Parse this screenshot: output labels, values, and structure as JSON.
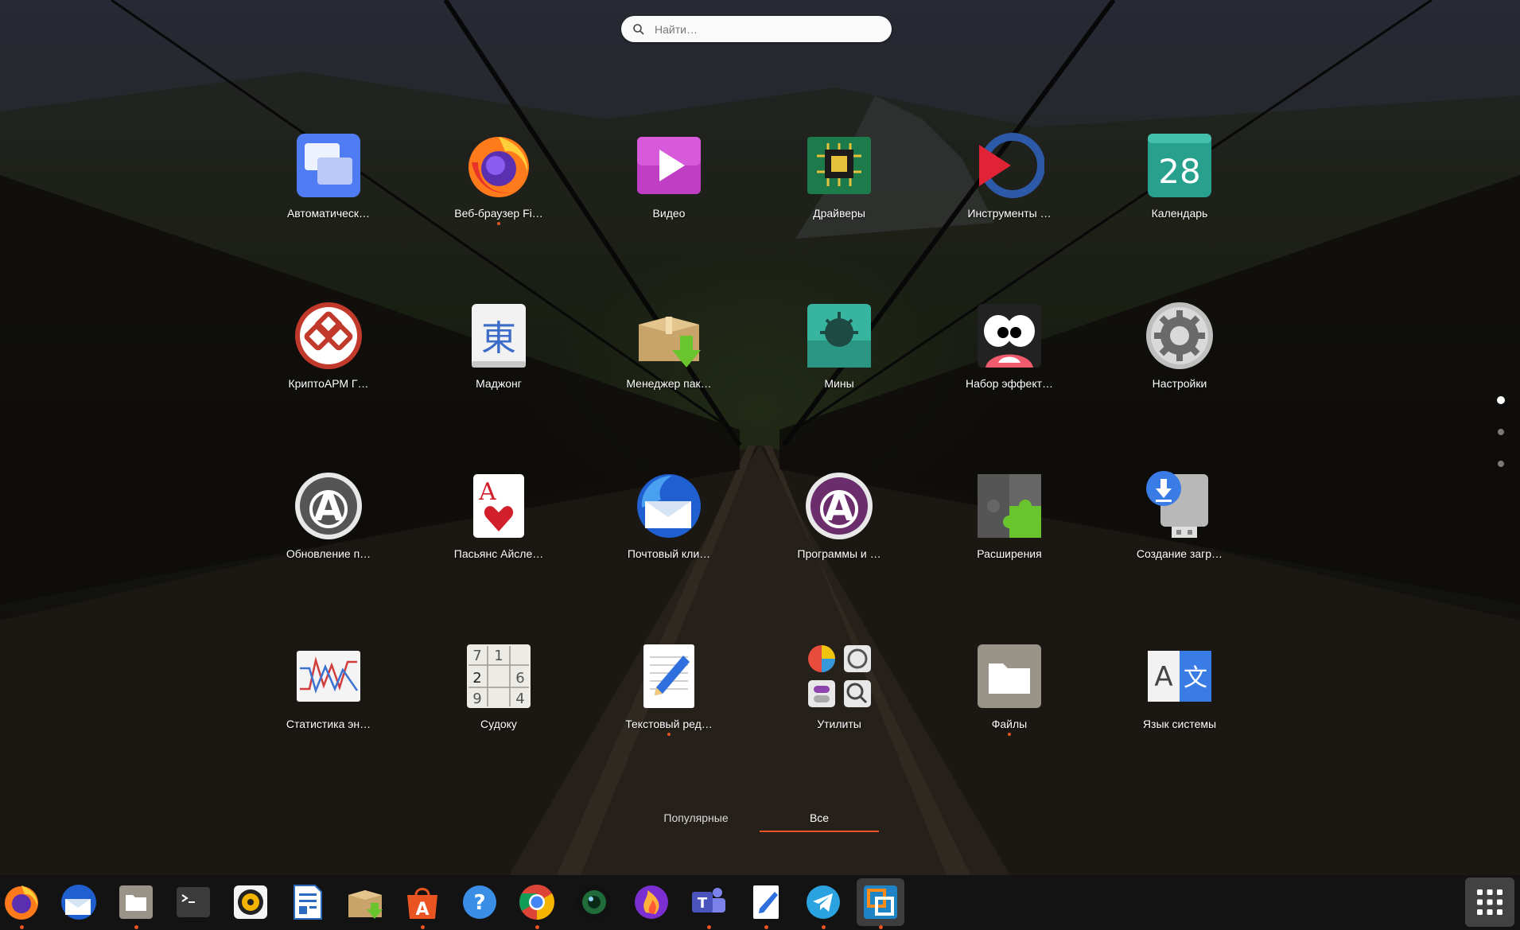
{
  "search": {
    "placeholder": "Найти…",
    "value": ""
  },
  "apps": [
    {
      "label": "Автоматическ…",
      "icon": "desktop-icon",
      "running": false
    },
    {
      "label": "Веб-браузер Fi…",
      "icon": "firefox-icon",
      "running": true
    },
    {
      "label": "Видео",
      "icon": "video-player-icon",
      "running": false
    },
    {
      "label": "Драйверы",
      "icon": "chip-icon",
      "running": false
    },
    {
      "label": "Инструменты …",
      "icon": "remote-desktop-icon",
      "running": false
    },
    {
      "label": "Календарь",
      "icon": "calendar-icon",
      "running": false,
      "calendar_day": "28"
    },
    {
      "label": "КриптоАРМ Г…",
      "icon": "crypto-chain-icon",
      "running": false
    },
    {
      "label": "Маджонг",
      "icon": "mahjong-tile-icon",
      "running": false,
      "glyph": "東"
    },
    {
      "label": "Менеджер пак…",
      "icon": "package-box-icon",
      "running": false
    },
    {
      "label": "Мины",
      "icon": "mine-icon",
      "running": false
    },
    {
      "label": "Набор эффект…",
      "icon": "cheese-face-icon",
      "running": false
    },
    {
      "label": "Настройки",
      "icon": "gear-icon",
      "running": false
    },
    {
      "label": "Обновление п…",
      "icon": "software-update-icon",
      "running": false
    },
    {
      "label": "Пасьянс Айсле…",
      "icon": "playing-card-icon",
      "running": false,
      "glyph": "A"
    },
    {
      "label": "Почтовый кли…",
      "icon": "thunderbird-icon",
      "running": false
    },
    {
      "label": "Программы и …",
      "icon": "software-center-icon",
      "running": false
    },
    {
      "label": "Расширения",
      "icon": "puzzle-icon",
      "running": false
    },
    {
      "label": "Создание загр…",
      "icon": "usb-download-icon",
      "running": false
    },
    {
      "label": "Статистика эн…",
      "icon": "power-graph-icon",
      "running": false
    },
    {
      "label": "Судоку",
      "icon": "sudoku-grid-icon",
      "running": false,
      "digits": [
        "7",
        "1",
        "2",
        "6",
        "9",
        "4"
      ]
    },
    {
      "label": "Текстовый ред…",
      "icon": "text-editor-icon",
      "running": true
    },
    {
      "label": "Утилиты",
      "icon": "utilities-folder-icon",
      "running": false
    },
    {
      "label": "Файлы",
      "icon": "files-folder-icon",
      "running": true
    },
    {
      "label": "Язык системы",
      "icon": "language-icon",
      "running": false,
      "glyph_a": "A",
      "glyph_b": "文"
    }
  ],
  "view_switcher": {
    "popular": "Популярные",
    "all": "Все",
    "active": "all"
  },
  "pages": {
    "count": 3,
    "current": 1
  },
  "dock": [
    {
      "name": "firefox-icon",
      "running": true
    },
    {
      "name": "thunderbird-icon",
      "running": false
    },
    {
      "name": "files-icon",
      "running": true
    },
    {
      "name": "terminal-icon",
      "running": false
    },
    {
      "name": "rhythmbox-icon",
      "running": false
    },
    {
      "name": "libreoffice-writer-icon",
      "running": false
    },
    {
      "name": "package-manager-icon",
      "running": false
    },
    {
      "name": "software-center-icon",
      "running": true
    },
    {
      "name": "help-icon",
      "running": false
    },
    {
      "name": "chrome-icon",
      "running": true
    },
    {
      "name": "camera-lens-icon",
      "running": false
    },
    {
      "name": "firefox-nightly-icon",
      "running": false
    },
    {
      "name": "teams-icon",
      "running": true
    },
    {
      "name": "text-editor-icon",
      "running": true
    },
    {
      "name": "telegram-icon",
      "running": true
    },
    {
      "name": "remote-viewer-icon",
      "running": true,
      "focused": true
    }
  ],
  "colors": {
    "accent": "#e95420"
  }
}
